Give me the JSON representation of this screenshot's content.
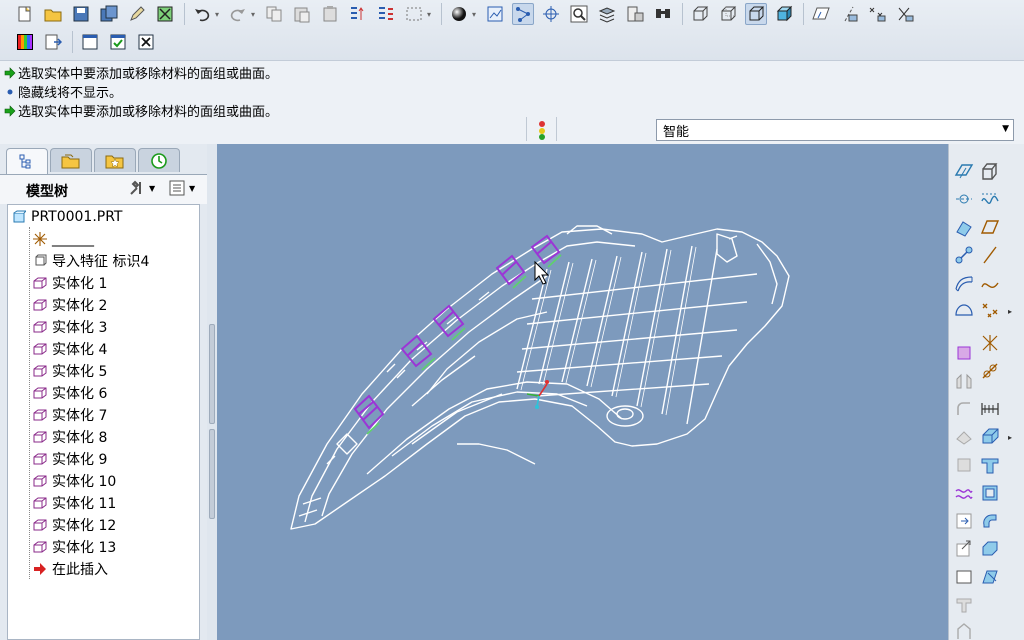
{
  "toolbar": {
    "row1": [
      "new-icon",
      "open-icon",
      "save-icon",
      "save-copy-icon",
      "edit-icon",
      "regenerate-icon",
      "undo-icon",
      "redo-icon",
      "copy-icon",
      "paste-icon",
      "paste-special-icon",
      "mirror-icon",
      "relations-icon",
      "select-box-icon",
      "shading-icon",
      "datum-plane-display-icon",
      "datum-axis-display-icon",
      "point-display-icon",
      "zoom-icon",
      "layers-icon",
      "view-manager-icon",
      "find-icon",
      "wireframe-icon",
      "hidden-line-icon",
      "no-hidden-icon",
      "shaded-icon",
      "plane-sketch-icon",
      "axis-tag-icon",
      "point-tag-icon",
      "csys-tag-icon"
    ],
    "row2": [
      "appearance-icon",
      "insert-mode-icon",
      "window-icon",
      "window-activate-icon",
      "close-window-icon"
    ]
  },
  "messages": [
    {
      "type": "prompt",
      "text": "选取实体中要添加或移除材料的面组或曲面。"
    },
    {
      "type": "info",
      "text": "隐藏线将不显示。"
    },
    {
      "type": "prompt",
      "text": "选取实体中要添加或移除材料的面组或曲面。"
    }
  ],
  "filter": {
    "value": "智能"
  },
  "navigator": {
    "tabs": [
      "model-tree-tab",
      "folder-browser-tab",
      "favorites-tab",
      "history-tab"
    ],
    "title": "模型树"
  },
  "tree": [
    {
      "label": "PRT0001.PRT",
      "icon": "part-icon",
      "level": 0
    },
    {
      "label": "______",
      "icon": "csys-icon",
      "level": 1
    },
    {
      "label": "导入特征 标识4",
      "icon": "import-feature-icon",
      "level": 1
    },
    {
      "label": "实体化 1",
      "icon": "solidify-icon",
      "level": 1
    },
    {
      "label": "实体化 2",
      "icon": "solidify-icon",
      "level": 1
    },
    {
      "label": "实体化 3",
      "icon": "solidify-icon",
      "level": 1
    },
    {
      "label": "实体化 4",
      "icon": "solidify-icon",
      "level": 1
    },
    {
      "label": "实体化 5",
      "icon": "solidify-icon",
      "level": 1
    },
    {
      "label": "实体化 6",
      "icon": "solidify-icon",
      "level": 1
    },
    {
      "label": "实体化 7",
      "icon": "solidify-icon",
      "level": 1
    },
    {
      "label": "实体化 8",
      "icon": "solidify-icon",
      "level": 1
    },
    {
      "label": "实体化 9",
      "icon": "solidify-icon",
      "level": 1
    },
    {
      "label": "实体化 10",
      "icon": "solidify-icon",
      "level": 1
    },
    {
      "label": "实体化 11",
      "icon": "solidify-icon",
      "level": 1
    },
    {
      "label": "实体化 12",
      "icon": "solidify-icon",
      "level": 1
    },
    {
      "label": "实体化 13",
      "icon": "solidify-icon",
      "level": 1
    },
    {
      "label": "在此插入",
      "icon": "insert-here-icon",
      "level": 1
    }
  ],
  "colors": {
    "canvas": "#7d9abd",
    "wireframe": "#ffffff",
    "highlight": "#9b35d6",
    "edge_green": "#5ed36a",
    "accent_green": "#1a9a1a"
  }
}
